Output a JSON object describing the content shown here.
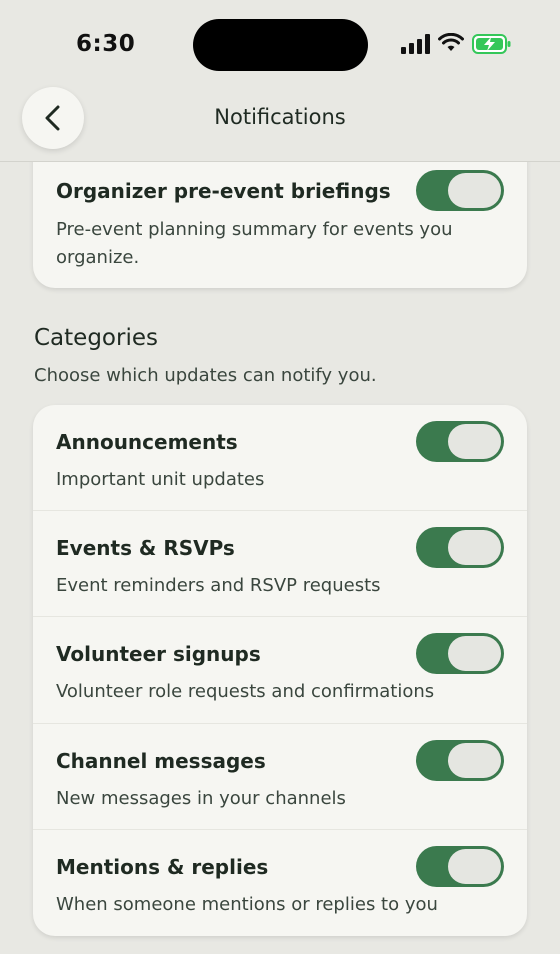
{
  "status": {
    "time": "6:30"
  },
  "header": {
    "title": "Notifications"
  },
  "briefing": {
    "title": "Organizer pre-event briefings",
    "description": "Pre-event planning summary for events you organize.",
    "enabled": true
  },
  "categories": {
    "title": "Categories",
    "subtitle": "Choose which updates can notify you.",
    "items": [
      {
        "title": "Announcements",
        "description": "Important unit updates",
        "enabled": true
      },
      {
        "title": "Events & RSVPs",
        "description": "Event reminders and RSVP requests",
        "enabled": true
      },
      {
        "title": "Volunteer signups",
        "description": "Volunteer role requests and confirmations",
        "enabled": true
      },
      {
        "title": "Channel messages",
        "description": "New messages in your channels",
        "enabled": true
      },
      {
        "title": "Mentions & replies",
        "description": "When someone mentions or replies to you",
        "enabled": true
      }
    ]
  },
  "colors": {
    "accent": "#3b7a4e",
    "background": "#e8e8e3",
    "card": "#f6f6f2"
  },
  "icons": {
    "back": "chevron-left-icon",
    "signal": "cellular-signal-icon",
    "wifi": "wifi-icon",
    "battery": "battery-charging-icon"
  }
}
